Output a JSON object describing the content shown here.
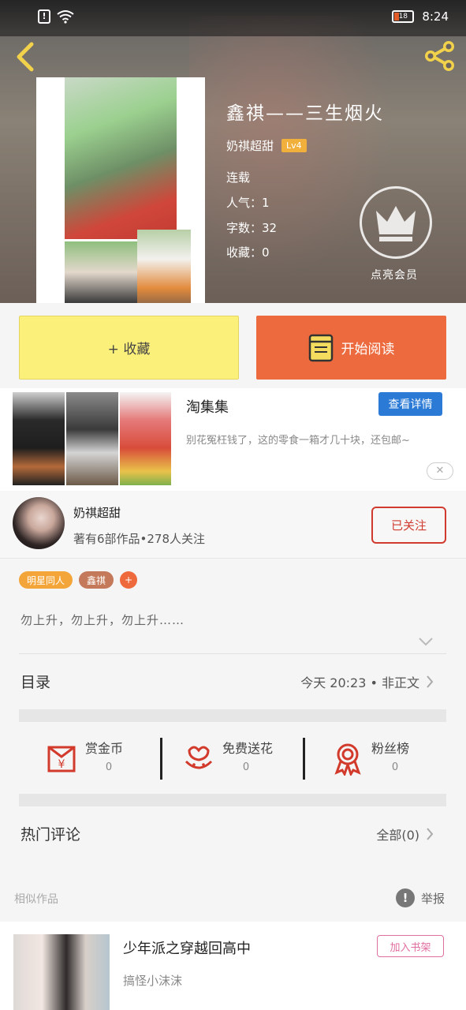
{
  "status_bar": {
    "time": "8:24",
    "battery": "18"
  },
  "book": {
    "title": "鑫祺——三生烟火",
    "author": "奶祺超甜",
    "level": "Lv4",
    "status": "连载",
    "popularity": "人气：1",
    "words": "字数：32",
    "favorites": "收藏：0",
    "vip_label": "点亮会员"
  },
  "actions": {
    "favorite": "+ 收藏",
    "read": "开始阅读"
  },
  "ad": {
    "title": "淘集集",
    "detail_button": "查看详情",
    "description": "别花冤枉钱了，这的零食一箱才几十块，还包邮~",
    "close": "✕"
  },
  "author_card": {
    "name": "奶祺超甜",
    "stats": "著有6部作品•278人关注",
    "follow": "已关注"
  },
  "tags": [
    "明星同人",
    "鑫祺",
    "+"
  ],
  "intro": "勿上升，勿上升，勿上升……",
  "catalog": {
    "label": "目录",
    "latest": "今天 20:23 • 非正文"
  },
  "rewards": [
    {
      "label": "赏金币",
      "value": "0"
    },
    {
      "label": "免费送花",
      "value": "0"
    },
    {
      "label": "粉丝榜",
      "value": "0"
    }
  ],
  "comments": {
    "label": "热门评论",
    "all": "全部(0)"
  },
  "similar": {
    "header": "相似作品",
    "report": "举报",
    "report_icon": "!",
    "item": {
      "title": "少年派之穿越回高中",
      "author": "搞怪小沫沫",
      "add": "加入书架"
    }
  },
  "colors": {
    "accent_orange": "#ec6a3d",
    "accent_yellow": "#fbf07a",
    "follow_red": "#d13b2f",
    "ad_blue": "#2a7ad6"
  }
}
